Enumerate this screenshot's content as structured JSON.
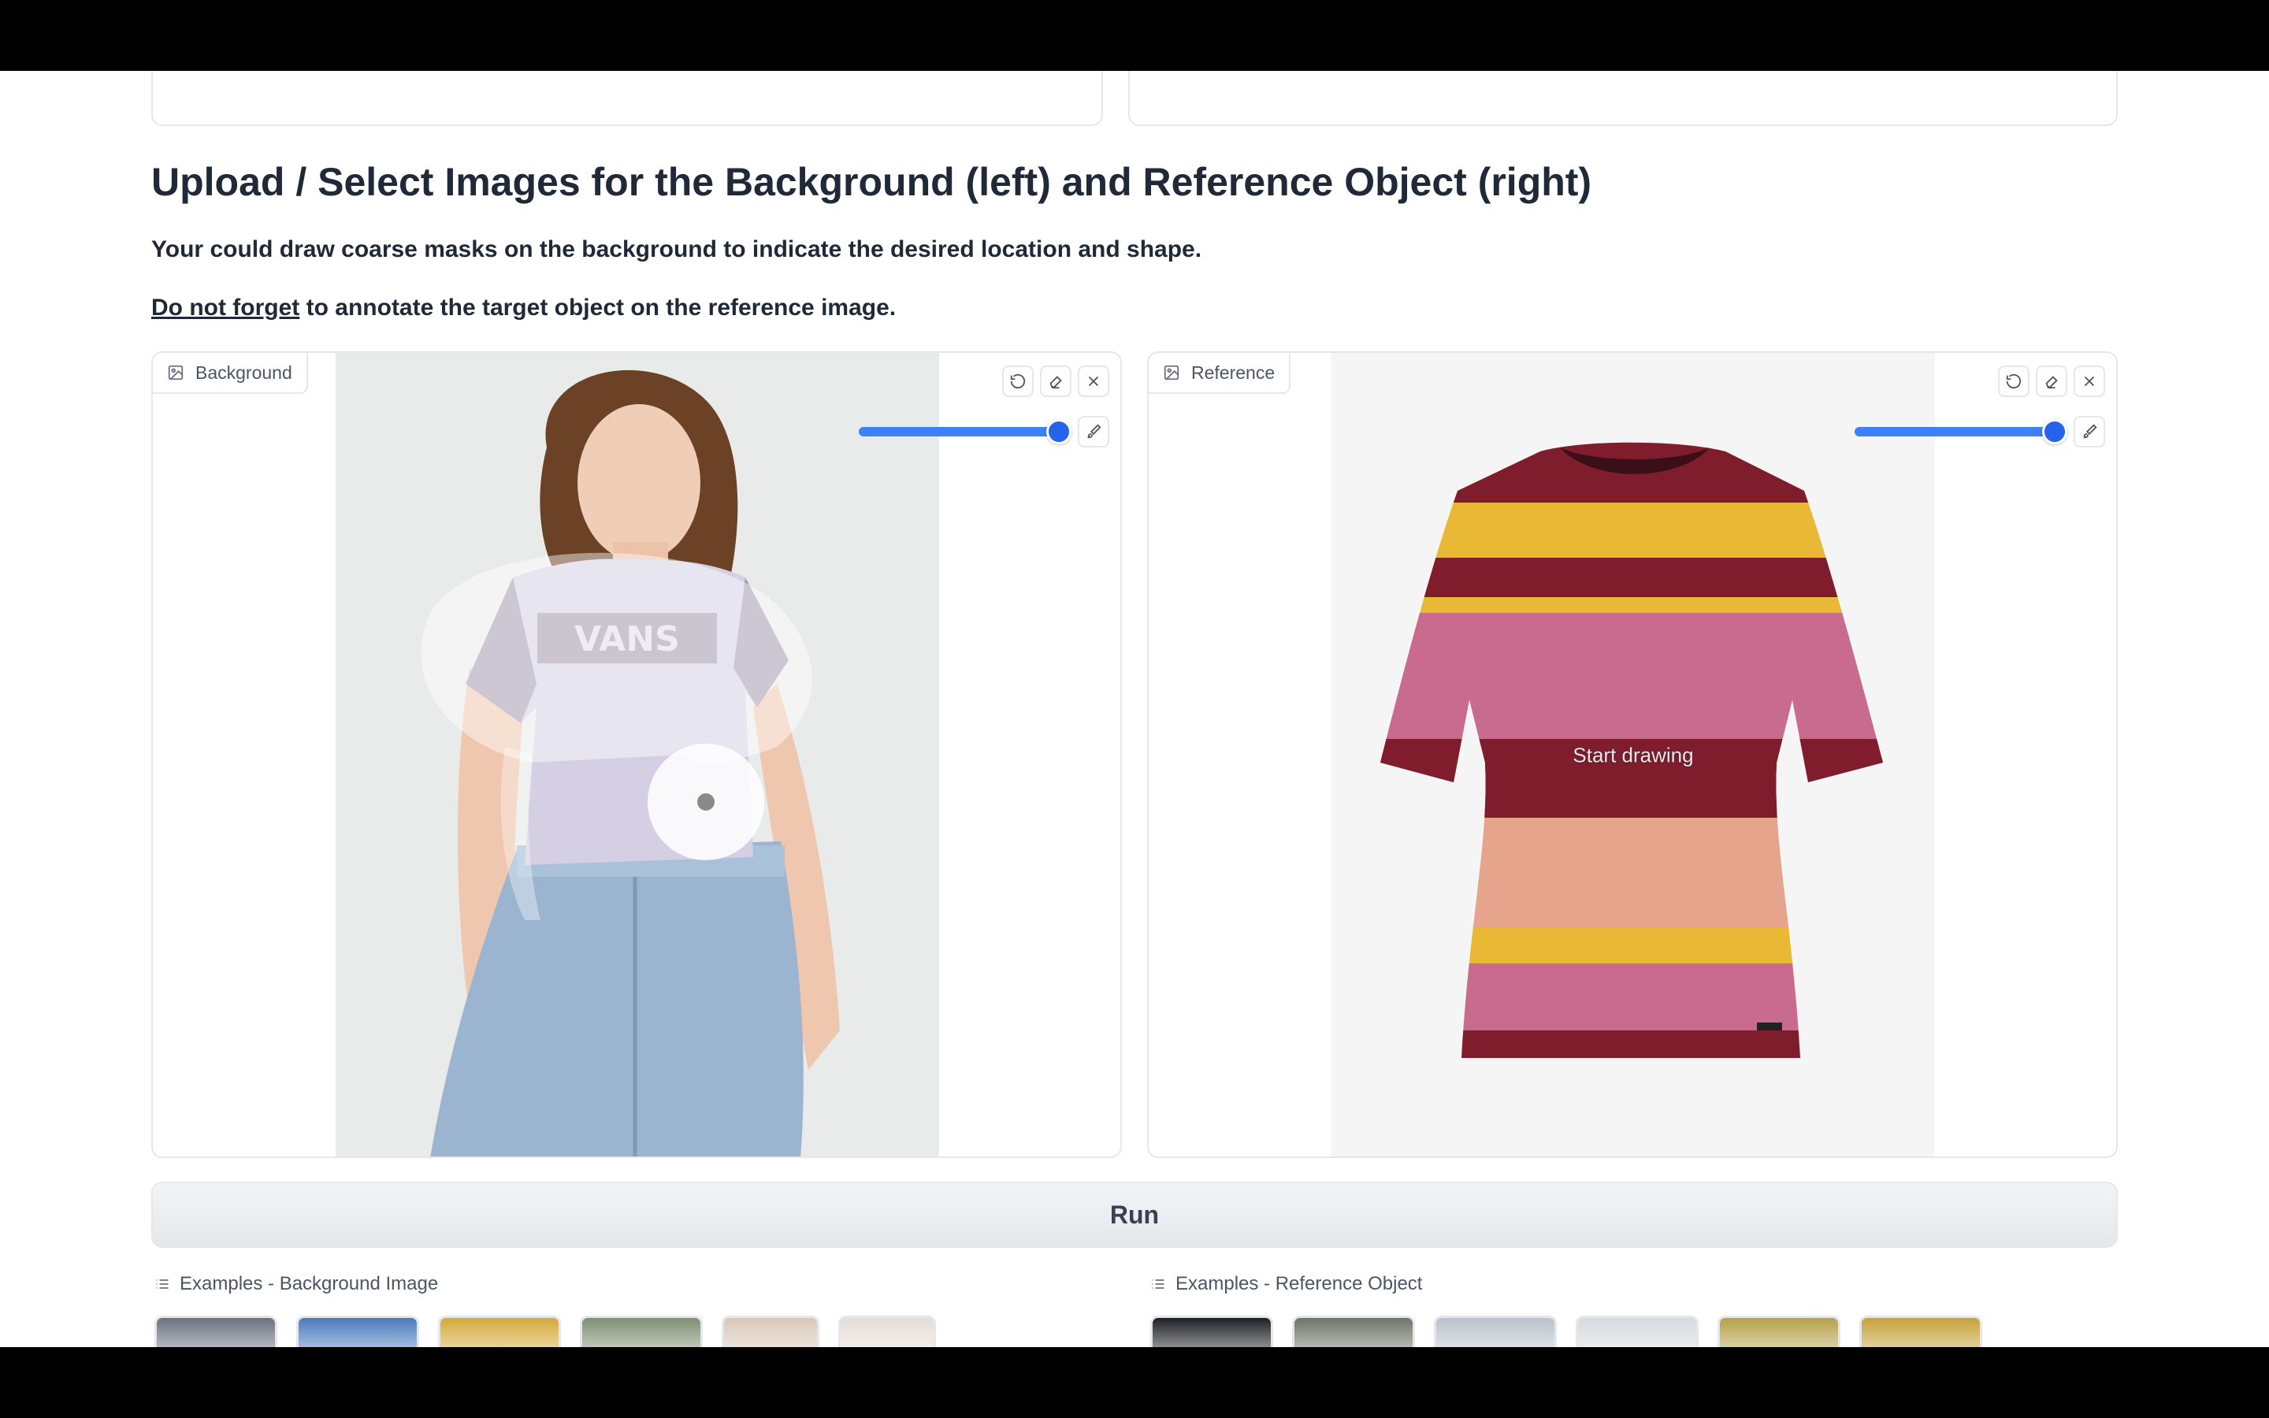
{
  "heading": "Upload / Select Images for the Background (left) and Reference Object (right)",
  "description": "Your could draw coarse masks on the background to indicate the desired location and shape.",
  "reminder": {
    "link": "Do not forget",
    "rest": " to annotate the target object on the reference image."
  },
  "background_editor": {
    "label": "Background",
    "brush_size_percent": 100,
    "tools": [
      "undo-icon",
      "eraser-icon",
      "close-icon",
      "brush-icon"
    ],
    "image_text": "VANS"
  },
  "reference_editor": {
    "label": "Reference",
    "hint": "Start drawing",
    "brush_size_percent": 100,
    "tools": [
      "undo-icon",
      "eraser-icon",
      "close-icon",
      "brush-icon"
    ]
  },
  "run_button": "Run",
  "examples_background": {
    "label": "Examples - Background Image",
    "thumb_colors": [
      "#6b7280",
      "#4b7bbd",
      "#d4a93a",
      "#7f8f74",
      "#d9c7b8",
      "#e5ddd6"
    ]
  },
  "examples_reference": {
    "label": "Examples - Reference Object",
    "thumb_colors": [
      "#1f2023",
      "#6d7566",
      "#b9c3cc",
      "#d6dadd",
      "#b5a24a",
      "#c5a23a"
    ]
  },
  "colors": {
    "accent": "#3b82f6",
    "border": "#e5e7eb"
  }
}
